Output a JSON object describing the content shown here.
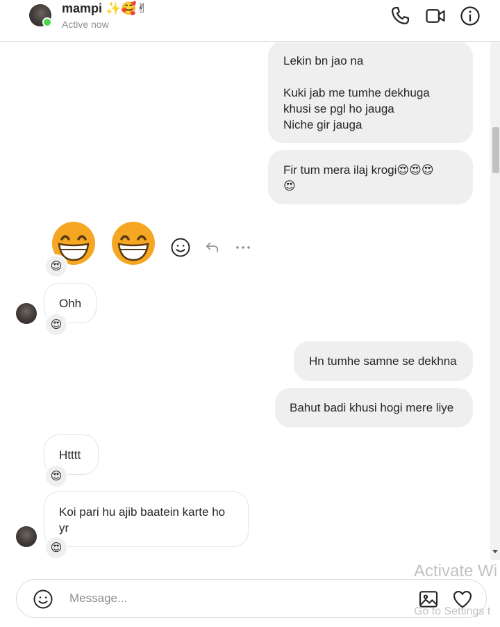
{
  "header": {
    "name": "mampi ✨🥰✌",
    "status": "Active now"
  },
  "messages": {
    "m1": "Lekin bn jao na\n\nKuki jab me tumhe dekhuga\nkhusi se pgl ho jauga\nNiche gir jauga",
    "m2": "Fir tum mera ilaj krogi😍😍😍\n😍",
    "m3": "Ohh",
    "m4": "Hn tumhe samne se dekhna",
    "m5": "Bahut badi khusi hogi mere liye",
    "m6": "Htttt",
    "m7": "Koi pari hu ajib baatein karte ho\nyr",
    "reaction": "😍"
  },
  "composer": {
    "placeholder": "Message..."
  },
  "watermark": {
    "line1": "Activate Wi",
    "line2": "Go to Settings t"
  },
  "colors": {
    "outgoing_bubble": "#efefef",
    "incoming_border": "#e3e3e3",
    "online": "#4cd548",
    "emoji_face": "#f5a623"
  },
  "icons": [
    "phone-icon",
    "video-icon",
    "info-icon",
    "smiley-icon",
    "reply-icon",
    "more-icon",
    "image-icon",
    "heart-icon"
  ]
}
